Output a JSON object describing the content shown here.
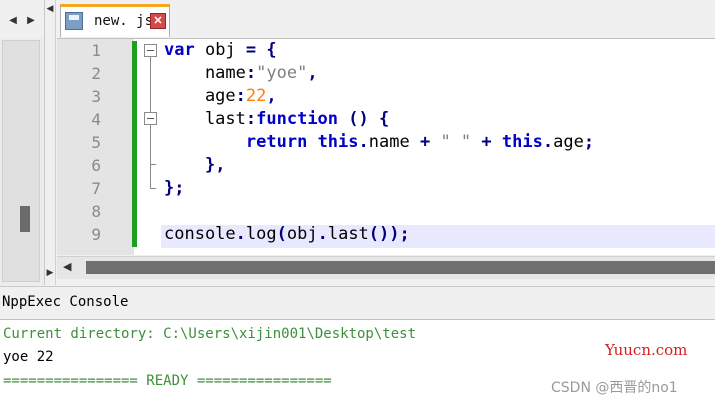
{
  "left_panel": {
    "left_arrow": "◀",
    "right_arrow": "▶"
  },
  "splitter": {
    "up_arrow": "◀",
    "down_arrow": "▶"
  },
  "tabs": [
    {
      "label": "new. js",
      "close": "✕"
    }
  ],
  "editor": {
    "line_numbers": [
      "1",
      "2",
      "3",
      "4",
      "5",
      "6",
      "7",
      "8",
      "9"
    ]
  },
  "code_lines": [
    [
      {
        "t": "var",
        "c": "kw"
      },
      {
        "t": " obj ",
        "c": ""
      },
      {
        "t": "=",
        "c": "op"
      },
      {
        "t": " ",
        "c": ""
      },
      {
        "t": "{",
        "c": "op"
      }
    ],
    [
      {
        "t": "    name",
        "c": ""
      },
      {
        "t": ":",
        "c": "op"
      },
      {
        "t": "\"yoe\"",
        "c": "str"
      },
      {
        "t": ",",
        "c": "op"
      }
    ],
    [
      {
        "t": "    age",
        "c": ""
      },
      {
        "t": ":",
        "c": "op"
      },
      {
        "t": "22",
        "c": "num"
      },
      {
        "t": ",",
        "c": "op"
      }
    ],
    [
      {
        "t": "    last",
        "c": ""
      },
      {
        "t": ":",
        "c": "op"
      },
      {
        "t": "function",
        "c": "kw"
      },
      {
        "t": " ",
        "c": ""
      },
      {
        "t": "()",
        "c": "op"
      },
      {
        "t": " ",
        "c": ""
      },
      {
        "t": "{",
        "c": "op"
      }
    ],
    [
      {
        "t": "        ",
        "c": ""
      },
      {
        "t": "return",
        "c": "kw"
      },
      {
        "t": " ",
        "c": ""
      },
      {
        "t": "this",
        "c": "kw"
      },
      {
        "t": ".",
        "c": "op"
      },
      {
        "t": "name ",
        "c": ""
      },
      {
        "t": "+",
        "c": "op"
      },
      {
        "t": " ",
        "c": ""
      },
      {
        "t": "\" \"",
        "c": "str"
      },
      {
        "t": " ",
        "c": ""
      },
      {
        "t": "+",
        "c": "op"
      },
      {
        "t": " ",
        "c": ""
      },
      {
        "t": "this",
        "c": "kw"
      },
      {
        "t": ".",
        "c": "op"
      },
      {
        "t": "age",
        "c": ""
      },
      {
        "t": ";",
        "c": "op"
      }
    ],
    [
      {
        "t": "    ",
        "c": ""
      },
      {
        "t": "},",
        "c": "op"
      }
    ],
    [
      {
        "t": "};",
        "c": "op"
      }
    ],
    [
      {
        "t": "",
        "c": ""
      }
    ],
    [
      {
        "t": "console",
        "c": ""
      },
      {
        "t": ".",
        "c": "op"
      },
      {
        "t": "log",
        "c": ""
      },
      {
        "t": "(",
        "c": "op"
      },
      {
        "t": "obj",
        "c": ""
      },
      {
        "t": ".",
        "c": "op"
      },
      {
        "t": "last",
        "c": ""
      },
      {
        "t": "());",
        "c": "op"
      }
    ]
  ],
  "hscroll": {
    "left_arrow": "◀"
  },
  "console": {
    "title": "NppExec Console",
    "lines": [
      {
        "text": "Current directory: C:\\Users\\xijin001\\Desktop\\test",
        "color": "green"
      },
      {
        "text": "yoe 22",
        "color": "black"
      },
      {
        "text": "================ READY ================",
        "color": "green"
      }
    ]
  },
  "watermarks": {
    "site": "Yuucn.com",
    "author": "CSDN @西晋的no1"
  }
}
